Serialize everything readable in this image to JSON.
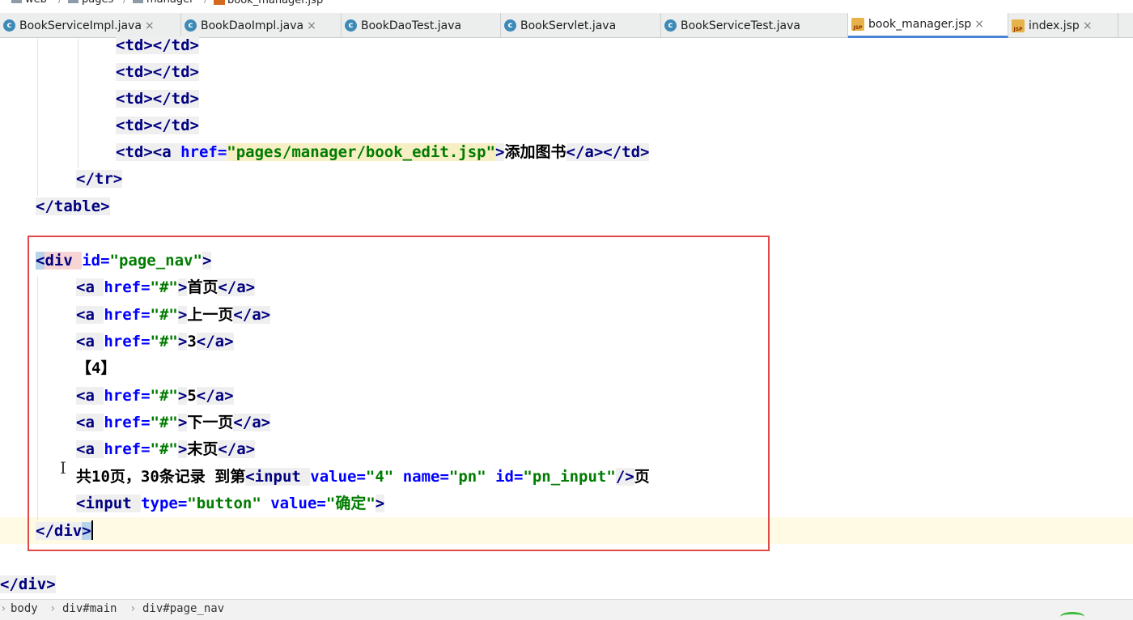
{
  "breadcrumb": {
    "items": [
      "web",
      "pages",
      "manager",
      "book_manager.jsp"
    ],
    "folder_icon": "folder-icon",
    "file_icon": "jsp-file-icon"
  },
  "tabs": [
    {
      "label": "BookServiceImpl.java",
      "icon": "java-class-icon",
      "icon_glyph": "c"
    },
    {
      "label": "BookDaoImpl.java",
      "icon": "java-class-icon",
      "icon_glyph": "c"
    },
    {
      "label": "BookDaoTest.java",
      "icon": "java-test-class-icon",
      "icon_glyph": "c"
    },
    {
      "label": "BookServlet.java",
      "icon": "java-class-icon",
      "icon_glyph": "c"
    },
    {
      "label": "BookServiceTest.java",
      "icon": "java-test-class-icon",
      "icon_glyph": "c"
    },
    {
      "label": "book_manager.jsp",
      "icon": "jsp-file-icon",
      "icon_glyph": "JSP",
      "active": true
    },
    {
      "label": "index.jsp",
      "icon": "jsp-file-icon",
      "icon_glyph": "JSP"
    }
  ],
  "close_glyph": "×",
  "code": {
    "td": "<td></td>",
    "td_open": "<td>",
    "a_open": "<a ",
    "href_attr": "href=",
    "edit_href": "\"pages/manager/book_edit.jsp\"",
    "gt": ">",
    "add_book": "添加图书",
    "a_close": "</a>",
    "td_close": "</td>",
    "tr_close": "</tr>",
    "table_close": "</table>",
    "div_lt": "<",
    "div_tag": "div ",
    "id_attr": "id=",
    "page_nav_val": "\"page_nav\"",
    "hash_val": "\"#\"",
    "first_page": "首页",
    "prev_page": "上一页",
    "page3": "3",
    "current_page": "【4】",
    "page5": "5",
    "next_page": "下一页",
    "last_page": "末页",
    "summary_text": "共10页，30条记录 到第",
    "input_open": "<input ",
    "value_attr": "value=",
    "pn_value": "\"4\"",
    "name_attr": " name=",
    "pn_name": "\"pn\"",
    "id_attr2": " id=",
    "pn_id": "\"pn_input\"",
    "self_close": "/>",
    "page_suffix": "页",
    "type_attr": "type=",
    "button_val": "\"button\"",
    "value_attr2": " value=",
    "confirm_val": "\"确定\"",
    "div_close_lt": "</div",
    "div_close_gt": ">",
    "outer_div_close": "</div>"
  },
  "status_bar": {
    "path": [
      "body",
      "div#main",
      "div#page_nav"
    ],
    "chevron": "›"
  },
  "colors": {
    "tag": "#000080",
    "attribute": "#0000ff",
    "value": "#007c00",
    "highlight_box": "#e04848",
    "active_tab_underline": "#4a82d8"
  }
}
